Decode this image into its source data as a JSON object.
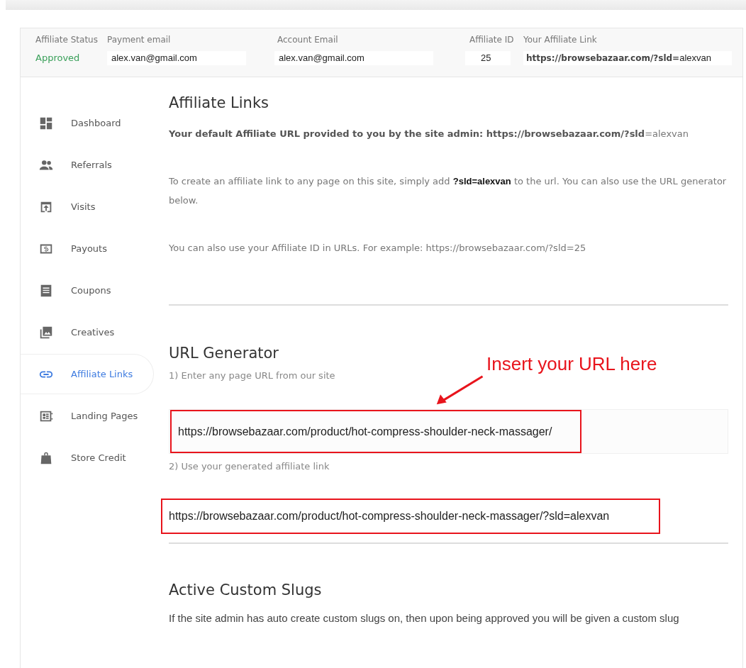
{
  "header": {
    "fields": [
      {
        "kind": "status",
        "label": "Affiliate Status",
        "value": "Approved"
      },
      {
        "kind": "field",
        "label": "Payment email",
        "value": "alex.van@gmail.com"
      },
      {
        "kind": "field",
        "label": "Account Email",
        "value": "alex.van@gmail.com"
      },
      {
        "kind": "field",
        "label": "Affiliate ID",
        "value": "25"
      },
      {
        "kind": "link",
        "label": "Your Affiliate Link",
        "value": "https://browsebazaar.com/?sld=",
        "suffix": "alexvan"
      }
    ]
  },
  "sidebar": {
    "items": [
      {
        "label": "Dashboard",
        "selected": false
      },
      {
        "label": "Referrals",
        "selected": false
      },
      {
        "label": "Visits",
        "selected": false
      },
      {
        "label": "Payouts",
        "selected": false
      },
      {
        "label": "Coupons",
        "selected": false
      },
      {
        "label": "Creatives",
        "selected": false
      },
      {
        "label": "Affiliate Links",
        "selected": true
      },
      {
        "label": "Landing Pages",
        "selected": false
      },
      {
        "label": "Store Credit",
        "selected": false
      }
    ]
  },
  "sections": [
    {
      "title": "Affiliate Links",
      "paragraphs": [
        "**Your default Affiliate URL provided to you by the site admin: https://browsebazaar.com/?sld**=alexvan",
        "To create an affiliate link to any page on this site, simply add **?sld=alexvan**           to the url. You can also use the URL generator below.",
        "You can also use your Affiliate ID in URLs. For example: https://browsebazaar.com/?sld=25"
      ]
    },
    {
      "title": "URL Generator",
      "steps": [
        {
          "label": "1) Enter any page URL from our site",
          "value": "https://browsebazaar.com/product/hot-compress-shoulder-neck-massager/",
          "highlighted": true,
          "annotation": "Insert your URL here"
        },
        {
          "label": "2) Use your generated affiliate link",
          "value": "https://browsebazaar.com/product/hot-compress-shoulder-neck-massager/?sld=alexvan",
          "highlighted": true
        }
      ]
    },
    {
      "title": "Active Custom Slugs",
      "paragraphs": [
        "If the site admin has auto create custom slugs on, then upon being approved you will be given a custom slug"
      ]
    }
  ]
}
